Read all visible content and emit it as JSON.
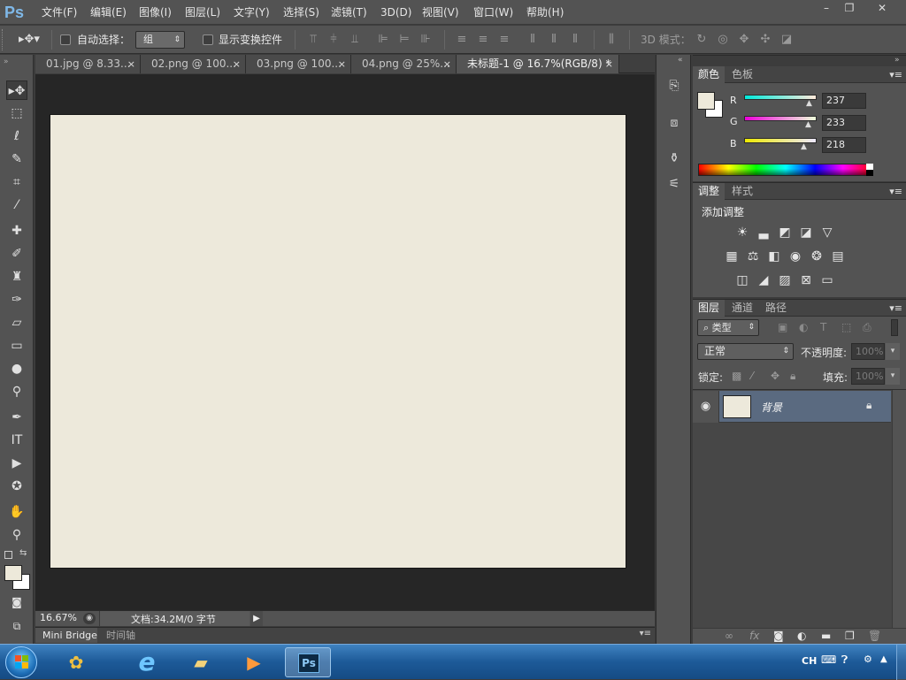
{
  "app": {
    "logo": "Ps"
  },
  "menu": [
    "文件(F)",
    "编辑(E)",
    "图像(I)",
    "图层(L)",
    "文字(Y)",
    "选择(S)",
    "滤镜(T)",
    "3D(D)",
    "视图(V)",
    "窗口(W)",
    "帮助(H)"
  ],
  "window_controls": {
    "minimize": "–",
    "restore": "❐",
    "close": "✕"
  },
  "options": {
    "auto_select_label": "自动选择：",
    "auto_select_value": "组",
    "show_transform_label": "显示变换控件",
    "mode_3d_label": "3D 模式："
  },
  "tabs": [
    {
      "label": "01.jpg @ 8.33...",
      "close": "×"
    },
    {
      "label": "02.png @ 100...",
      "close": "×"
    },
    {
      "label": "03.png @ 100...",
      "close": "×"
    },
    {
      "label": "04.png @ 25%...",
      "close": "×"
    },
    {
      "label": "未标题-1 @ 16.7%(RGB/8) *",
      "close": "×"
    }
  ],
  "status": {
    "zoom": "16.67%",
    "doc_info": "文档:34.2M/0 字节"
  },
  "mini_tabs": [
    "Mini Bridge",
    "时间轴"
  ],
  "color_panel": {
    "tabs": [
      "颜色",
      "色板"
    ],
    "channels": [
      {
        "label": "R",
        "value": "237"
      },
      {
        "label": "G",
        "value": "233"
      },
      {
        "label": "B",
        "value": "218"
      }
    ],
    "foreground": "#ede9da",
    "background": "#ffffff"
  },
  "adjust_panel": {
    "tabs": [
      "调整",
      "样式"
    ],
    "title": "添加调整"
  },
  "layers_panel": {
    "tabs": [
      "图层",
      "通道",
      "路径"
    ],
    "filter_label": "类型",
    "blend_mode": "正常",
    "opacity_label": "不透明度:",
    "opacity_value": "100%",
    "lock_label": "锁定:",
    "fill_label": "填充:",
    "fill_value": "100%",
    "layers": [
      {
        "name": "背景"
      }
    ],
    "bottom_icons": [
      "link-icon",
      "fx-icon",
      "mask-icon",
      "adjustment-icon",
      "folder-icon",
      "new-layer-icon",
      "trash-icon"
    ]
  },
  "taskbar": {
    "lang": "CH",
    "ps_label": "Ps"
  },
  "colors": {
    "accent": "#7fb8e8",
    "canvas": "#ede9db",
    "workspace": "#262626",
    "panel": "#535353",
    "selected_layer": "#5a6a80"
  }
}
